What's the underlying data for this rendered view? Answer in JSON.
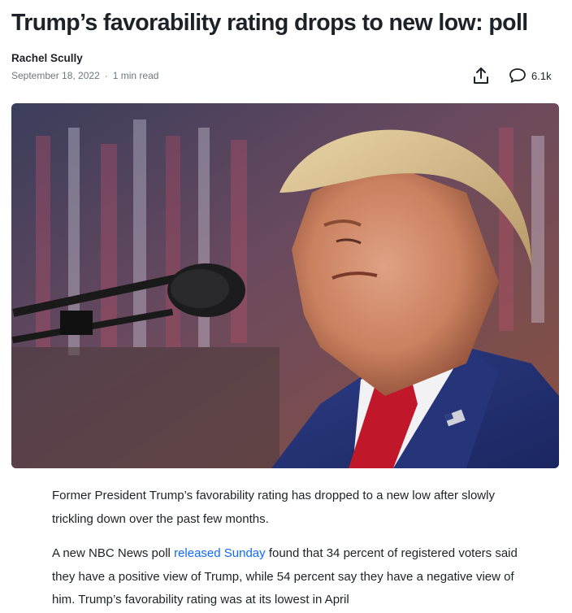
{
  "article": {
    "headline": "Trump’s favorability rating drops to new low: poll",
    "author": "Rachel Scully",
    "date": "September 18, 2022",
    "separator": "·",
    "read_time": "1 min read",
    "comment_count": "6.1k",
    "paragraph_1": "Former President Trump’s favorability rating has dropped to a new low after slowly trickling down over the past few months.",
    "paragraph_2_before": "A new NBC News poll ",
    "paragraph_2_link": "released Sunday",
    "paragraph_2_after": " found that 34 percent of registered voters said they have a positive view of Trump, while 54 percent say they have a negative view of him. Trump’s favorability rating was at its lowest in April"
  },
  "icons": {
    "share": "share-upload-icon",
    "comment": "comment-bubble-icon"
  },
  "colors": {
    "link": "#0f69ff",
    "text": "#1d2228",
    "muted": "#6e7780"
  }
}
